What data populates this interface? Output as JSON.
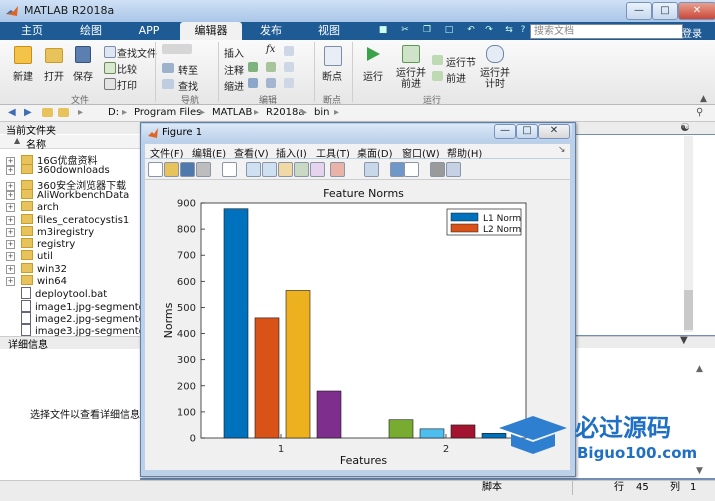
{
  "window": {
    "title": "MATLAB R2018a"
  },
  "tabs": [
    {
      "label": "主页"
    },
    {
      "label": "绘图"
    },
    {
      "label": "APP"
    },
    {
      "label": "编辑器",
      "active": true
    },
    {
      "label": "发布"
    },
    {
      "label": "视图"
    }
  ],
  "search": {
    "placeholder": "搜索文档"
  },
  "login": "登录",
  "ribbon": {
    "file": {
      "new": "新建",
      "open": "打开",
      "save": "保存",
      "find_files": "查找文件",
      "compare": "比较",
      "print": "打印",
      "group": "文件"
    },
    "nav": {
      "goto": "转至",
      "find": "查找",
      "group": "导航"
    },
    "edit": {
      "insert": "插入",
      "comment": "注释",
      "indent": "缩进",
      "fx": "fx",
      "group": "编辑"
    },
    "breakpoints": {
      "label": "断点",
      "group": "断点"
    },
    "run": {
      "run": "运行",
      "run_advance": "运行并\n前进",
      "run_section": "运行节",
      "advance": "前进",
      "run_time": "运行并\n计时",
      "group": "运行"
    }
  },
  "address": {
    "crumbs": [
      "D:",
      "Program Files",
      "MATLAB",
      "R2018a",
      "bin"
    ]
  },
  "current_folder": {
    "title": "当前文件夹",
    "column": "名称",
    "items": [
      {
        "name": "16G优盘资料",
        "type": "folder"
      },
      {
        "name": "360downloads",
        "type": "folder"
      },
      {
        "name": "360安全浏览器下载",
        "type": "folder"
      },
      {
        "name": "AliWorkbenchData",
        "type": "folder"
      },
      {
        "name": "arch",
        "type": "folder"
      },
      {
        "name": "files_ceratocystis1",
        "type": "folder"
      },
      {
        "name": "m3iregistry",
        "type": "folder"
      },
      {
        "name": "registry",
        "type": "folder"
      },
      {
        "name": "util",
        "type": "folder"
      },
      {
        "name": "win32",
        "type": "folder"
      },
      {
        "name": "win64",
        "type": "folder"
      },
      {
        "name": "deploytool.bat",
        "type": "file"
      },
      {
        "name": "image1.jpg-segmente...",
        "type": "file"
      },
      {
        "name": "image2.jpg-segmente...",
        "type": "file"
      },
      {
        "name": "image3.jpg-segmente...",
        "type": "file"
      }
    ]
  },
  "details": {
    "title": "详细信息",
    "hint": "选择文件以查看详细信息"
  },
  "status": {
    "script": "脚本",
    "row_label": "行",
    "row": "45",
    "col_label": "列",
    "col": "1"
  },
  "figure": {
    "title": "Figure 1",
    "menu": [
      "文件(F)",
      "编辑(E)",
      "查看(V)",
      "插入(I)",
      "工具(T)",
      "桌面(D)",
      "窗口(W)",
      "帮助(H)"
    ]
  },
  "chart_data": {
    "type": "bar",
    "title": "Feature Norms",
    "xlabel": "Features",
    "ylabel": "Norms",
    "categories": [
      "1",
      "2"
    ],
    "ylim": [
      0,
      900
    ],
    "yticks": [
      0,
      100,
      200,
      300,
      400,
      500,
      600,
      700,
      800,
      900
    ],
    "legend": {
      "placement": "top-right",
      "entries": [
        {
          "name": "L1 Norm",
          "color": "#0072BD"
        },
        {
          "name": "L2 Norm",
          "color": "#D95319"
        }
      ]
    },
    "bars": [
      {
        "group": "1",
        "value": 878,
        "color": "#0072BD"
      },
      {
        "group": "1",
        "value": 460,
        "color": "#D95319"
      },
      {
        "group": "1",
        "value": 565,
        "color": "#EDB120"
      },
      {
        "group": "1",
        "value": 180,
        "color": "#7E2F8E"
      },
      {
        "group": "2",
        "value": 70,
        "color": "#77AC30"
      },
      {
        "group": "2",
        "value": 35,
        "color": "#4DBEEE"
      },
      {
        "group": "2",
        "value": 50,
        "color": "#A2142F"
      },
      {
        "group": "2",
        "value": 18,
        "color": "#0072BD"
      }
    ]
  },
  "watermark": {
    "cn": "必过源码",
    "en": "Biguo100.com"
  }
}
